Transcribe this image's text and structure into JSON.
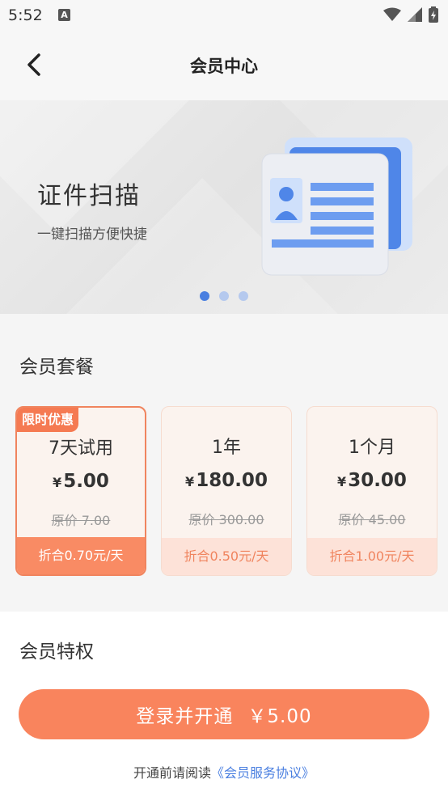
{
  "status_bar": {
    "time": "5:52",
    "notification_letter": "A"
  },
  "header": {
    "title": "会员中心"
  },
  "banner": {
    "title": "证件扫描",
    "subtitle": "一键扫描方便快捷",
    "slide_count": 3,
    "active_slide": 1
  },
  "plans": {
    "section_title": "会员套餐",
    "badge": "限时优惠",
    "items": [
      {
        "name": "7天试用",
        "currency": "¥",
        "price": "5.00",
        "original": "原价 7.00",
        "per_day": "折合0.70元/天",
        "selected": true
      },
      {
        "name": "1年",
        "currency": "¥",
        "price": "180.00",
        "original": "原价 300.00",
        "per_day": "折合0.50元/天",
        "selected": false
      },
      {
        "name": "1个月",
        "currency": "¥",
        "price": "30.00",
        "original": "原价 45.00",
        "per_day": "折合1.00元/天",
        "selected": false
      }
    ]
  },
  "privileges": {
    "title": "会员特权"
  },
  "cta": {
    "label": "登录并开通",
    "price": "￥5.00"
  },
  "agreement": {
    "prefix": "开通前请阅读",
    "link": "《会员服务协议》"
  },
  "colors": {
    "accent": "#f9845d",
    "link": "#4a7fe0",
    "card_bg": "#fbf3ee"
  }
}
